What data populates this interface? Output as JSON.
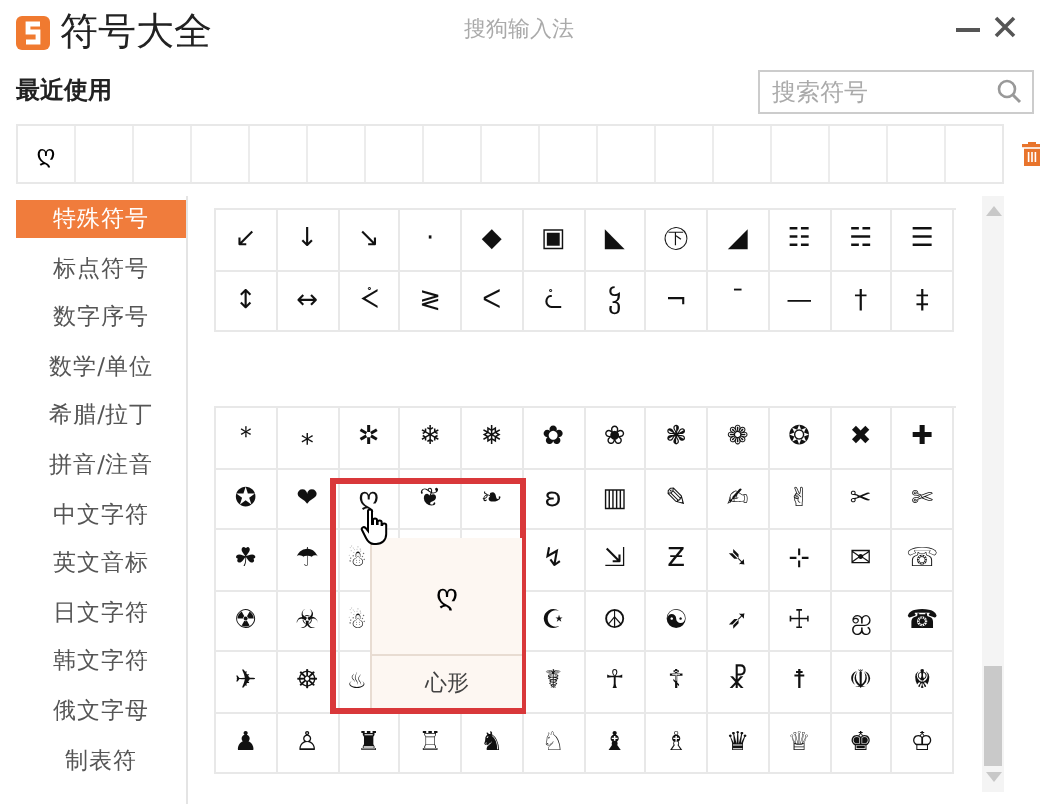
{
  "window": {
    "title": "符号大全",
    "subtitle": "搜狗输入法"
  },
  "recent": {
    "label": "最近使用",
    "symbols": [
      "ღ"
    ]
  },
  "search": {
    "placeholder": "搜索符号"
  },
  "sidebar": {
    "items": [
      {
        "label": "特殊符号",
        "selected": true
      },
      {
        "label": "标点符号",
        "selected": false
      },
      {
        "label": "数字序号",
        "selected": false
      },
      {
        "label": "数学/单位",
        "selected": false
      },
      {
        "label": "希腊/拉丁",
        "selected": false
      },
      {
        "label": "拼音/注音",
        "selected": false
      },
      {
        "label": "中文字符",
        "selected": false
      },
      {
        "label": "英文音标",
        "selected": false
      },
      {
        "label": "日文字符",
        "selected": false
      },
      {
        "label": "韩文字符",
        "selected": false
      },
      {
        "label": "俄文字母",
        "selected": false
      },
      {
        "label": "制表符",
        "selected": false
      }
    ]
  },
  "groups": [
    {
      "rows": [
        [
          "↙",
          "↓",
          "↘",
          "·",
          "◆",
          "▣",
          "◣",
          "㊦",
          "◢",
          "☷",
          "☵",
          "☰"
        ],
        [
          "↕",
          "↔",
          "ᢵ",
          "≷",
          "ᐸ",
          "ᢽ",
          "ჴ",
          "¬",
          "ˉ",
          "—",
          "†",
          "‡"
        ]
      ]
    },
    {
      "rows": [
        [
          "＊",
          "⁎",
          "✲",
          "❄",
          "❅",
          "✿",
          "❀",
          "❃",
          "❁",
          "❂",
          "✖",
          "✚"
        ],
        [
          "✪",
          "❤",
          "ღ",
          "❦",
          "❧",
          "ʚ",
          "▥",
          "✎",
          "✍",
          "✌",
          "✂",
          "✄"
        ],
        [
          "☘",
          "☂",
          "☃",
          "",
          "",
          "↯",
          "⇲",
          "Ƶ",
          "➴",
          "⊹",
          "✉",
          "☏"
        ],
        [
          "☢",
          "☣",
          "☃",
          "",
          "",
          "☪",
          "☮",
          "☯",
          "➶",
          "☩",
          "ஐ",
          "☎"
        ],
        [
          "✈",
          "☸",
          "♨",
          "",
          "",
          "☤",
          "☥",
          "☦",
          "☧",
          "☨",
          "☫",
          "☬"
        ],
        [
          "♟",
          "♙",
          "♜",
          "♖",
          "♞",
          "♘",
          "♝",
          "♗",
          "♛",
          "♕",
          "♚",
          "♔"
        ]
      ]
    }
  ],
  "popup": {
    "symbol": "ღ",
    "name": "心形"
  }
}
